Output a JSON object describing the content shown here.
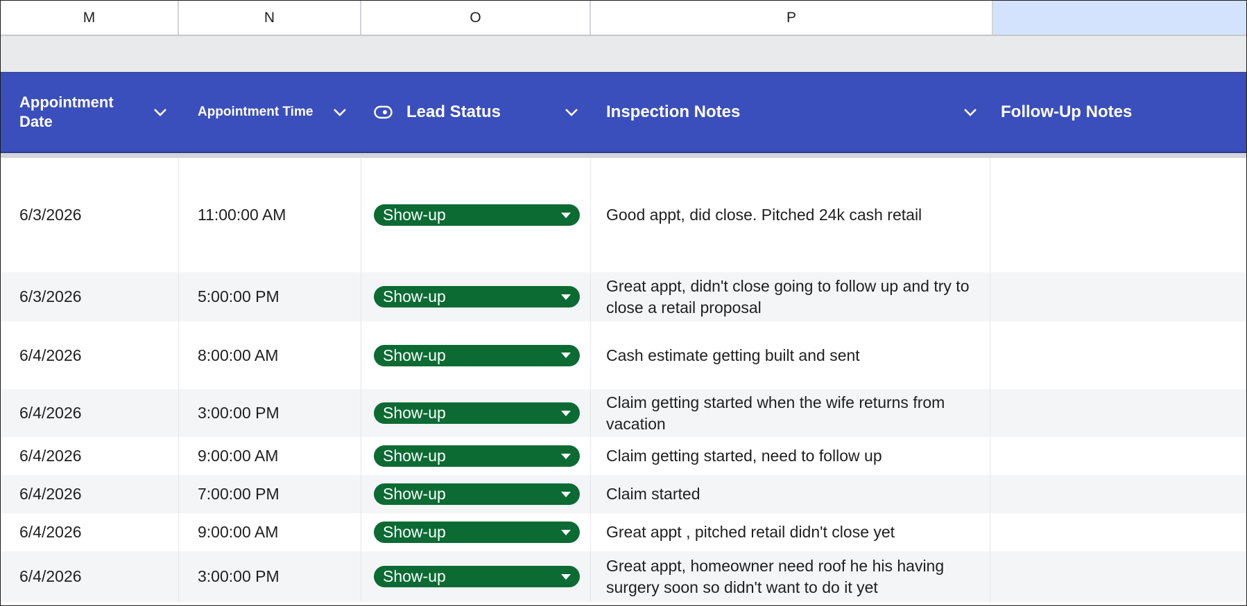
{
  "column_letters": [
    "M",
    "N",
    "O",
    "P",
    ""
  ],
  "headers": {
    "appointment_date": "Appointment Date",
    "appointment_time": "Appointment Time",
    "lead_status": "Lead Status",
    "inspection_notes": "Inspection Notes",
    "follow_up_notes": "Follow-Up Notes"
  },
  "colors": {
    "header_bg": "#3a4fbb",
    "chip_bg": "#0b6b33",
    "selected_column": "#d3e3fd"
  },
  "icons": {
    "status_header": "status-toggle-icon",
    "filter": "chevron-down-icon",
    "chip": "dropdown-arrow-icon"
  },
  "rows": [
    {
      "date": "6/3/2026",
      "time": "11:00:00 AM",
      "status": "Show-up",
      "notes": "Good appt, did close. Pitched 24k cash retail",
      "follow_up": ""
    },
    {
      "date": "6/3/2026",
      "time": "5:00:00 PM",
      "status": "Show-up",
      "notes": "Great appt, didn't close going to follow up and try to close a retail proposal",
      "follow_up": ""
    },
    {
      "date": "6/4/2026",
      "time": "8:00:00 AM",
      "status": "Show-up",
      "notes": "Cash estimate getting built and sent",
      "follow_up": ""
    },
    {
      "date": "6/4/2026",
      "time": "3:00:00 PM",
      "status": "Show-up",
      "notes": "Claim getting started when the wife returns from vacation",
      "follow_up": ""
    },
    {
      "date": "6/4/2026",
      "time": "9:00:00 AM",
      "status": "Show-up",
      "notes": "Claim getting started, need to follow up",
      "follow_up": ""
    },
    {
      "date": "6/4/2026",
      "time": "7:00:00 PM",
      "status": "Show-up",
      "notes": "Claim started",
      "follow_up": ""
    },
    {
      "date": "6/4/2026",
      "time": "9:00:00 AM",
      "status": "Show-up",
      "notes": "Great appt , pitched retail didn't close yet",
      "follow_up": ""
    },
    {
      "date": "6/4/2026",
      "time": "3:00:00 PM",
      "status": "Show-up",
      "notes": "Great appt, homeowner need roof he his having surgery soon so didn't want to do it yet",
      "follow_up": ""
    }
  ]
}
